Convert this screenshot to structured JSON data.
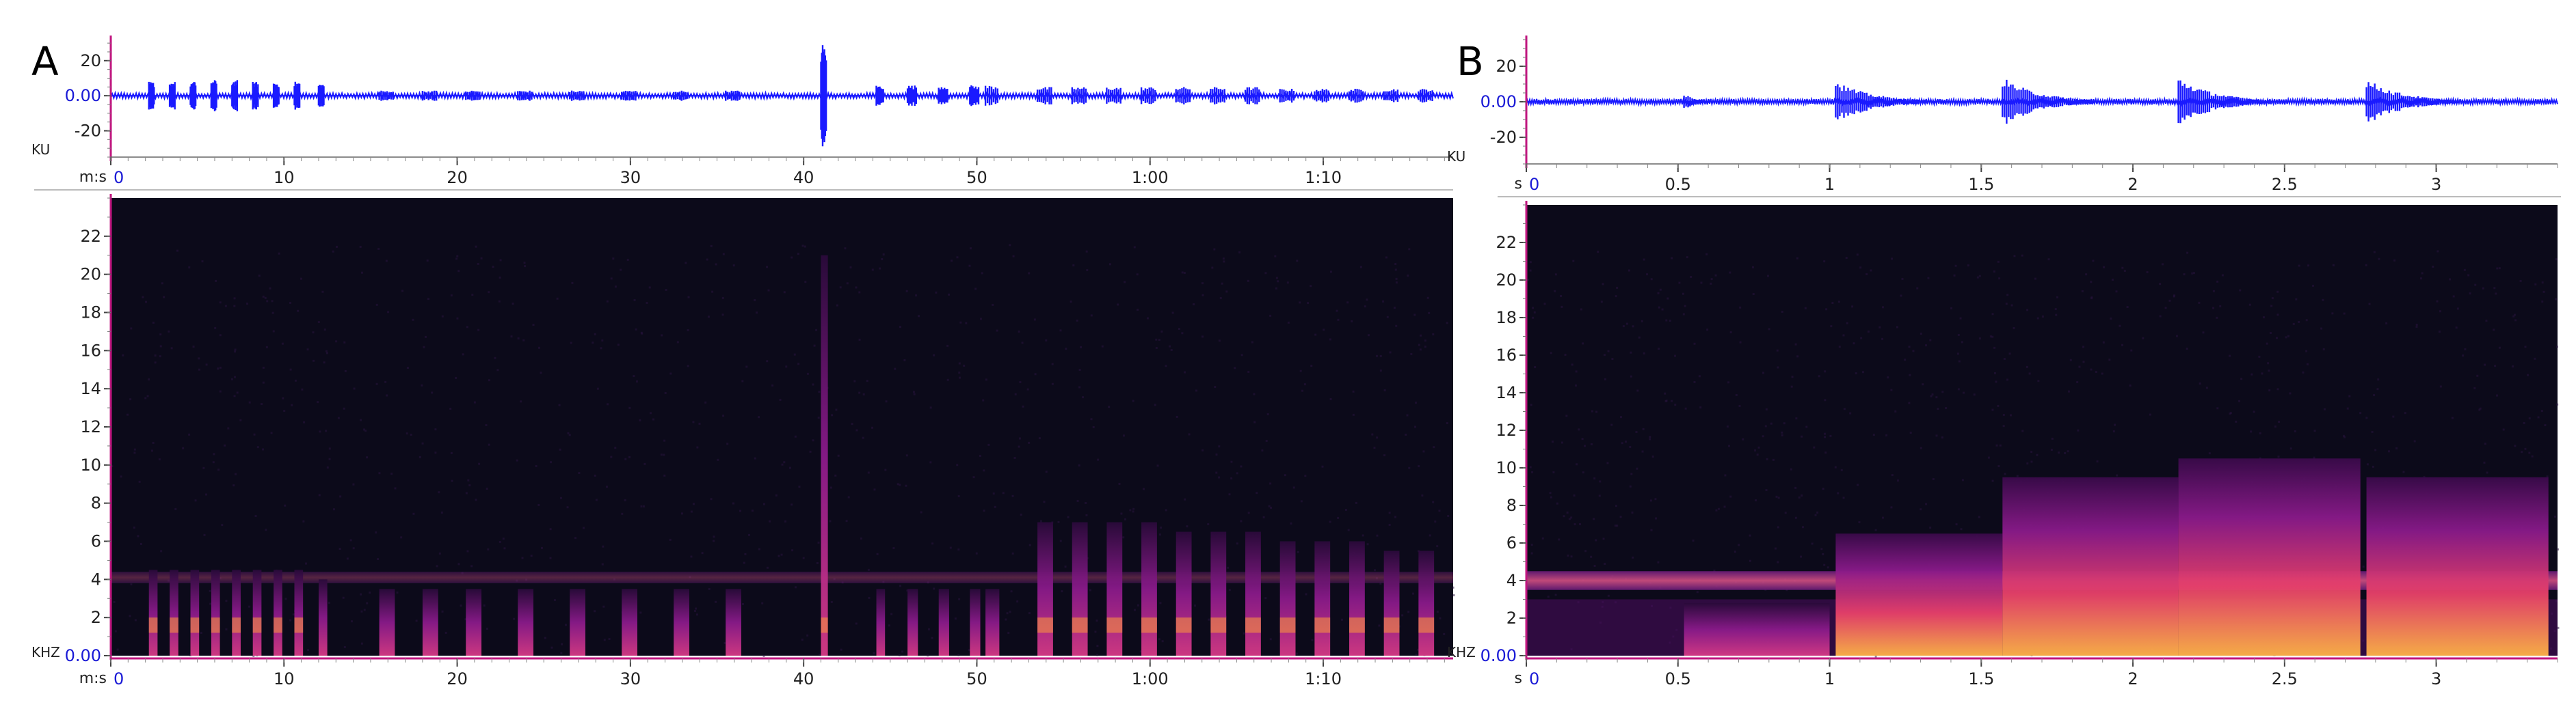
{
  "colors": {
    "waveform": "#1a1aff",
    "axis_accent": "#c0157f",
    "zero_label": "#1a1ad6",
    "spectrogram_bg": "#0c0a1a",
    "spectrogram_low": "#5a0d6e",
    "spectrogram_mid": "#c0207a",
    "spectrogram_high": "#ff9a3a"
  },
  "chart_data": [
    {
      "type": "line",
      "panel": "A",
      "kind": "waveform",
      "ylabel": "KU",
      "xlabel": "m:s",
      "xlim": [
        0,
        77.5
      ],
      "ylim": [
        -35,
        32
      ],
      "yticks": [
        {
          "v": 20,
          "label": "20"
        },
        {
          "v": 0,
          "label": "0.00"
        },
        {
          "v": -20,
          "label": "-20"
        }
      ],
      "xticks": [
        {
          "v": 0,
          "label": "0"
        },
        {
          "v": 10,
          "label": "10"
        },
        {
          "v": 20,
          "label": "20"
        },
        {
          "v": 30,
          "label": "30"
        },
        {
          "v": 40,
          "label": "40"
        },
        {
          "v": 50,
          "label": "50"
        },
        {
          "v": 60,
          "label": "1:00"
        },
        {
          "v": 70,
          "label": "1:10"
        }
      ],
      "events": [
        {
          "t": 2.2,
          "w": 0.3,
          "a": 8
        },
        {
          "t": 3.4,
          "w": 0.3,
          "a": 8
        },
        {
          "t": 4.6,
          "w": 0.3,
          "a": 8
        },
        {
          "t": 5.8,
          "w": 0.3,
          "a": 9
        },
        {
          "t": 7.0,
          "w": 0.3,
          "a": 9
        },
        {
          "t": 8.2,
          "w": 0.3,
          "a": 8
        },
        {
          "t": 9.4,
          "w": 0.3,
          "a": 8
        },
        {
          "t": 10.6,
          "w": 0.3,
          "a": 8
        },
        {
          "t": 12.0,
          "w": 0.3,
          "a": 7
        },
        {
          "t": 15.5,
          "w": 0.8,
          "a": 3
        },
        {
          "t": 18.0,
          "w": 0.8,
          "a": 3
        },
        {
          "t": 20.5,
          "w": 0.8,
          "a": 3
        },
        {
          "t": 23.5,
          "w": 0.8,
          "a": 3
        },
        {
          "t": 26.5,
          "w": 0.8,
          "a": 3
        },
        {
          "t": 29.5,
          "w": 0.8,
          "a": 3
        },
        {
          "t": 32.5,
          "w": 0.8,
          "a": 3
        },
        {
          "t": 35.5,
          "w": 0.8,
          "a": 3
        },
        {
          "t": 41.0,
          "w": 0.3,
          "a": 30
        },
        {
          "t": 44.2,
          "w": 0.4,
          "a": 6
        },
        {
          "t": 46.0,
          "w": 0.5,
          "a": 6
        },
        {
          "t": 47.8,
          "w": 0.5,
          "a": 6
        },
        {
          "t": 49.6,
          "w": 0.5,
          "a": 6
        },
        {
          "t": 50.5,
          "w": 0.7,
          "a": 6
        },
        {
          "t": 53.5,
          "w": 0.8,
          "a": 5
        },
        {
          "t": 55.5,
          "w": 0.8,
          "a": 5
        },
        {
          "t": 57.5,
          "w": 0.8,
          "a": 5
        },
        {
          "t": 59.5,
          "w": 0.8,
          "a": 5
        },
        {
          "t": 61.5,
          "w": 0.8,
          "a": 5
        },
        {
          "t": 63.5,
          "w": 0.8,
          "a": 5
        },
        {
          "t": 65.5,
          "w": 0.8,
          "a": 5
        },
        {
          "t": 67.5,
          "w": 0.8,
          "a": 4
        },
        {
          "t": 69.5,
          "w": 0.8,
          "a": 4
        },
        {
          "t": 71.5,
          "w": 0.8,
          "a": 4
        },
        {
          "t": 73.5,
          "w": 0.8,
          "a": 4
        },
        {
          "t": 75.5,
          "w": 0.8,
          "a": 4
        }
      ]
    },
    {
      "type": "heatmap",
      "panel": "A",
      "kind": "spectrogram",
      "ylabel": "KHZ",
      "xlabel": "m:s",
      "xlim": [
        0,
        77.5
      ],
      "ylim": [
        0,
        24
      ],
      "yticks": [
        {
          "v": 0,
          "label": "0.00"
        },
        {
          "v": 2,
          "label": "2"
        },
        {
          "v": 4,
          "label": "4"
        },
        {
          "v": 6,
          "label": "6"
        },
        {
          "v": 8,
          "label": "8"
        },
        {
          "v": 10,
          "label": "10"
        },
        {
          "v": 12,
          "label": "12"
        },
        {
          "v": 14,
          "label": "14"
        },
        {
          "v": 16,
          "label": "16"
        },
        {
          "v": 18,
          "label": "18"
        },
        {
          "v": 20,
          "label": "20"
        },
        {
          "v": 22,
          "label": "22"
        }
      ],
      "xticks": [
        {
          "v": 0,
          "label": "0"
        },
        {
          "v": 10,
          "label": "10"
        },
        {
          "v": 20,
          "label": "20"
        },
        {
          "v": 30,
          "label": "30"
        },
        {
          "v": 40,
          "label": "40"
        },
        {
          "v": 50,
          "label": "50"
        },
        {
          "v": 60,
          "label": "1:00"
        },
        {
          "v": 70,
          "label": "1:10"
        }
      ],
      "bands": [
        {
          "f0": 3.8,
          "f1": 4.4,
          "intensity": 0.35
        }
      ],
      "events": [
        {
          "t": 2.2,
          "w": 0.5,
          "fmax": 4.5
        },
        {
          "t": 3.4,
          "w": 0.5,
          "fmax": 4.5
        },
        {
          "t": 4.6,
          "w": 0.5,
          "fmax": 4.5
        },
        {
          "t": 5.8,
          "w": 0.5,
          "fmax": 4.5
        },
        {
          "t": 7.0,
          "w": 0.5,
          "fmax": 4.5
        },
        {
          "t": 8.2,
          "w": 0.5,
          "fmax": 4.5
        },
        {
          "t": 9.4,
          "w": 0.5,
          "fmax": 4.5
        },
        {
          "t": 10.6,
          "w": 0.5,
          "fmax": 4.5
        },
        {
          "t": 12.0,
          "w": 0.5,
          "fmax": 4.0
        },
        {
          "t": 15.5,
          "w": 0.9,
          "fmax": 3.5
        },
        {
          "t": 18.0,
          "w": 0.9,
          "fmax": 3.5
        },
        {
          "t": 20.5,
          "w": 0.9,
          "fmax": 3.5
        },
        {
          "t": 23.5,
          "w": 0.9,
          "fmax": 3.5
        },
        {
          "t": 26.5,
          "w": 0.9,
          "fmax": 3.5
        },
        {
          "t": 29.5,
          "w": 0.9,
          "fmax": 3.5
        },
        {
          "t": 32.5,
          "w": 0.9,
          "fmax": 3.5
        },
        {
          "t": 35.5,
          "w": 0.9,
          "fmax": 3.5
        },
        {
          "t": 41.0,
          "w": 0.4,
          "fmax": 21
        },
        {
          "t": 44.2,
          "w": 0.5,
          "fmax": 3.5
        },
        {
          "t": 46.0,
          "w": 0.6,
          "fmax": 3.5
        },
        {
          "t": 47.8,
          "w": 0.6,
          "fmax": 3.5
        },
        {
          "t": 49.6,
          "w": 0.6,
          "fmax": 3.5
        },
        {
          "t": 50.5,
          "w": 0.8,
          "fmax": 3.5
        },
        {
          "t": 53.5,
          "w": 0.9,
          "fmax": 7
        },
        {
          "t": 55.5,
          "w": 0.9,
          "fmax": 7
        },
        {
          "t": 57.5,
          "w": 0.9,
          "fmax": 7
        },
        {
          "t": 59.5,
          "w": 0.9,
          "fmax": 7
        },
        {
          "t": 61.5,
          "w": 0.9,
          "fmax": 6.5
        },
        {
          "t": 63.5,
          "w": 0.9,
          "fmax": 6.5
        },
        {
          "t": 65.5,
          "w": 0.9,
          "fmax": 6.5
        },
        {
          "t": 67.5,
          "w": 0.9,
          "fmax": 6
        },
        {
          "t": 69.5,
          "w": 0.9,
          "fmax": 6
        },
        {
          "t": 71.5,
          "w": 0.9,
          "fmax": 6
        },
        {
          "t": 73.5,
          "w": 0.9,
          "fmax": 5.5
        },
        {
          "t": 75.5,
          "w": 0.9,
          "fmax": 5.5
        }
      ]
    },
    {
      "type": "line",
      "panel": "B",
      "kind": "waveform",
      "ylabel": "KU",
      "xlabel": "s",
      "xlim": [
        0,
        3.4
      ],
      "ylim": [
        -35,
        35
      ],
      "yticks": [
        {
          "v": 20,
          "label": "20"
        },
        {
          "v": 0,
          "label": "0.00"
        },
        {
          "v": -20,
          "label": "-20"
        }
      ],
      "xticks": [
        {
          "v": 0,
          "label": "0"
        },
        {
          "v": 0.5,
          "label": "0.5"
        },
        {
          "v": 1,
          "label": "1"
        },
        {
          "v": 1.5,
          "label": "1.5"
        },
        {
          "v": 2,
          "label": "2"
        },
        {
          "v": 2.5,
          "label": "2.5"
        },
        {
          "v": 3,
          "label": "3"
        }
      ],
      "events": [
        {
          "t": 0.52,
          "w": 0.1,
          "a": 5
        },
        {
          "t": 1.02,
          "w": 0.3,
          "a": 12
        },
        {
          "t": 1.57,
          "w": 0.3,
          "a": 14
        },
        {
          "t": 2.15,
          "w": 0.3,
          "a": 14
        },
        {
          "t": 2.77,
          "w": 0.3,
          "a": 13
        }
      ]
    },
    {
      "type": "heatmap",
      "panel": "B",
      "kind": "spectrogram",
      "ylabel": "KHZ",
      "xlabel": "s",
      "xlim": [
        0,
        3.4
      ],
      "ylim": [
        0,
        24
      ],
      "yticks": [
        {
          "v": 0,
          "label": "0.00"
        },
        {
          "v": 2,
          "label": "2"
        },
        {
          "v": 4,
          "label": "4"
        },
        {
          "v": 6,
          "label": "6"
        },
        {
          "v": 8,
          "label": "8"
        },
        {
          "v": 10,
          "label": "10"
        },
        {
          "v": 12,
          "label": "12"
        },
        {
          "v": 14,
          "label": "14"
        },
        {
          "v": 16,
          "label": "16"
        },
        {
          "v": 18,
          "label": "18"
        },
        {
          "v": 20,
          "label": "20"
        },
        {
          "v": 22,
          "label": "22"
        }
      ],
      "xticks": [
        {
          "v": 0,
          "label": "0"
        },
        {
          "v": 0.5,
          "label": "0.5"
        },
        {
          "v": 1,
          "label": "1"
        },
        {
          "v": 1.5,
          "label": "1.5"
        },
        {
          "v": 2,
          "label": "2"
        },
        {
          "v": 2.5,
          "label": "2.5"
        },
        {
          "v": 3,
          "label": "3"
        }
      ],
      "bands": [
        {
          "f0": 3.5,
          "f1": 4.5,
          "intensity": 0.85
        },
        {
          "f0": 0,
          "f1": 3.0,
          "intensity": 0.45
        }
      ],
      "events": [
        {
          "t": 0.52,
          "w": 0.48,
          "fmax": 2.8
        },
        {
          "t": 1.02,
          "w": 0.55,
          "fmax": 6.5
        },
        {
          "t": 1.57,
          "w": 0.58,
          "fmax": 9.5
        },
        {
          "t": 2.15,
          "w": 0.6,
          "fmax": 10.5
        },
        {
          "t": 2.77,
          "w": 0.6,
          "fmax": 9.5
        }
      ]
    }
  ],
  "panel_labels": {
    "a": "A",
    "b": "B"
  }
}
